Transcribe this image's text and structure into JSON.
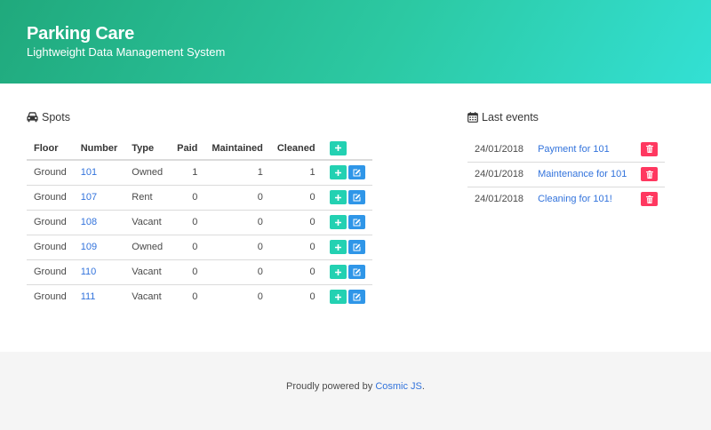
{
  "hero": {
    "title": "Parking Care",
    "subtitle": "Lightweight Data Management System",
    "gradient_start": "#20a97c",
    "gradient_end": "#33e0d4"
  },
  "spots": {
    "title": "Spots",
    "icon": "car-icon",
    "headers": [
      "Floor",
      "Number",
      "Type",
      "Paid",
      "Maintained",
      "Cleaned"
    ],
    "rows": [
      {
        "floor": "Ground",
        "number": "101",
        "type": "Owned",
        "paid": "1",
        "maintained": "1",
        "cleaned": "1"
      },
      {
        "floor": "Ground",
        "number": "107",
        "type": "Rent",
        "paid": "0",
        "maintained": "0",
        "cleaned": "0"
      },
      {
        "floor": "Ground",
        "number": "108",
        "type": "Vacant",
        "paid": "0",
        "maintained": "0",
        "cleaned": "0"
      },
      {
        "floor": "Ground",
        "number": "109",
        "type": "Owned",
        "paid": "0",
        "maintained": "0",
        "cleaned": "0"
      },
      {
        "floor": "Ground",
        "number": "110",
        "type": "Vacant",
        "paid": "0",
        "maintained": "0",
        "cleaned": "0"
      },
      {
        "floor": "Ground",
        "number": "111",
        "type": "Vacant",
        "paid": "0",
        "maintained": "0",
        "cleaned": "0"
      }
    ]
  },
  "events": {
    "title": "Last events",
    "icon": "calendar-icon",
    "items": [
      {
        "date": "24/01/2018",
        "label": "Payment for 101"
      },
      {
        "date": "24/01/2018",
        "label": "Maintenance for 101"
      },
      {
        "date": "24/01/2018",
        "label": "Cleaning for 101!"
      }
    ]
  },
  "footer": {
    "prefix": "Proudly powered by ",
    "link": "Cosmic JS",
    "suffix": "."
  },
  "colors": {
    "add": "#23d1b2",
    "edit": "#2f96e8",
    "delete": "#ff3860",
    "link": "#3273dc"
  }
}
